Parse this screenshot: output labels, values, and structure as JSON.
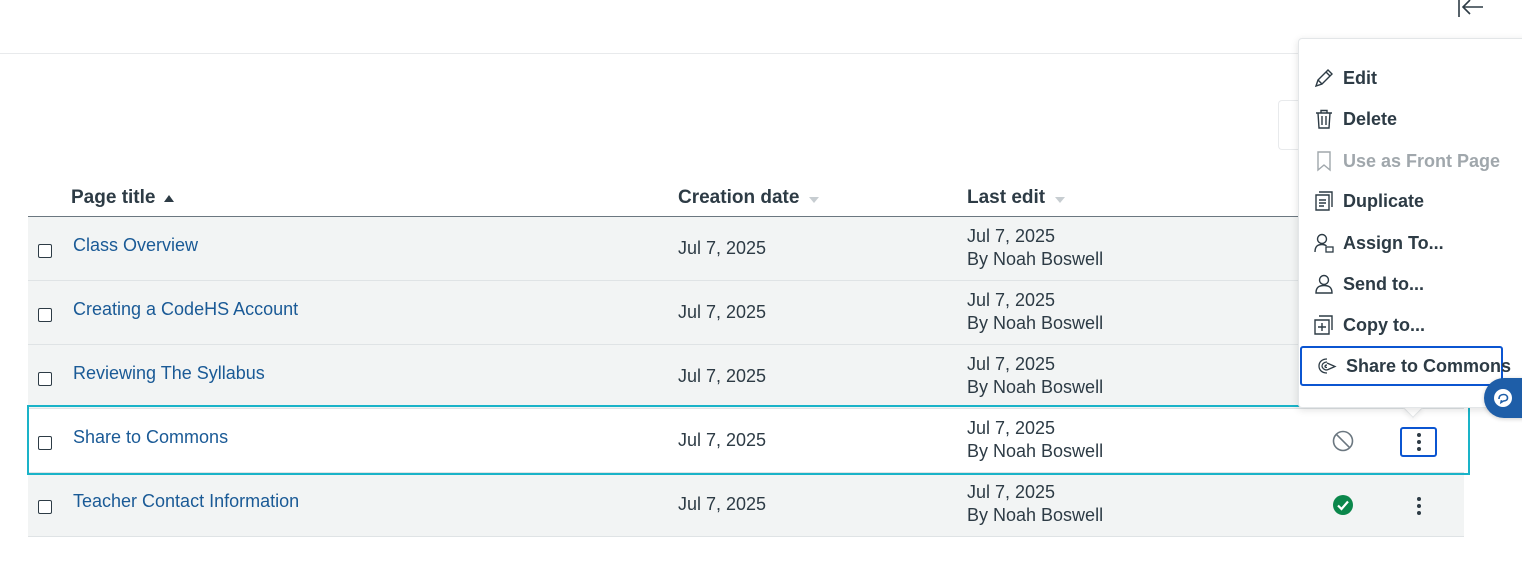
{
  "table": {
    "headers": {
      "title": "Page title",
      "created": "Creation date",
      "edited": "Last edit"
    },
    "rows": [
      {
        "title": "Class Overview",
        "created": "Jul 7, 2025",
        "edit_date": "Jul 7, 2025",
        "edit_by": "By Noah Boswell"
      },
      {
        "title": "Creating a CodeHS Account",
        "created": "Jul 7, 2025",
        "edit_date": "Jul 7, 2025",
        "edit_by": "By Noah Boswell"
      },
      {
        "title": "Reviewing The Syllabus",
        "created": "Jul 7, 2025",
        "edit_date": "Jul 7, 2025",
        "edit_by": "By Noah Boswell"
      },
      {
        "title": "Share to Commons",
        "created": "Jul 7, 2025",
        "edit_date": "Jul 7, 2025",
        "edit_by": "By Noah Boswell",
        "status_icon": "unpublished-icon"
      },
      {
        "title": "Teacher Contact Information",
        "created": "Jul 7, 2025",
        "edit_date": "Jul 7, 2025",
        "edit_by": "By Noah Boswell",
        "status_icon": "published-icon"
      }
    ]
  },
  "menu": {
    "items": [
      {
        "label": "Edit",
        "icon": "pencil-icon"
      },
      {
        "label": "Delete",
        "icon": "trash-icon"
      },
      {
        "label": "Use as Front Page",
        "icon": "bookmark-icon",
        "disabled": true
      },
      {
        "label": "Duplicate",
        "icon": "duplicate-icon"
      },
      {
        "label": "Assign To...",
        "icon": "assign-user-icon"
      },
      {
        "label": "Send to...",
        "icon": "user-icon"
      },
      {
        "label": "Copy to...",
        "icon": "copy-plus-icon"
      },
      {
        "label": "Share to Commons",
        "icon": "commons-icon"
      }
    ]
  },
  "colors": {
    "link": "#1a5a96",
    "focus_row_border": "#1ab3c8",
    "focus_border": "#0b55d1",
    "published": "#0b874b",
    "fab": "#1e5ea8"
  }
}
